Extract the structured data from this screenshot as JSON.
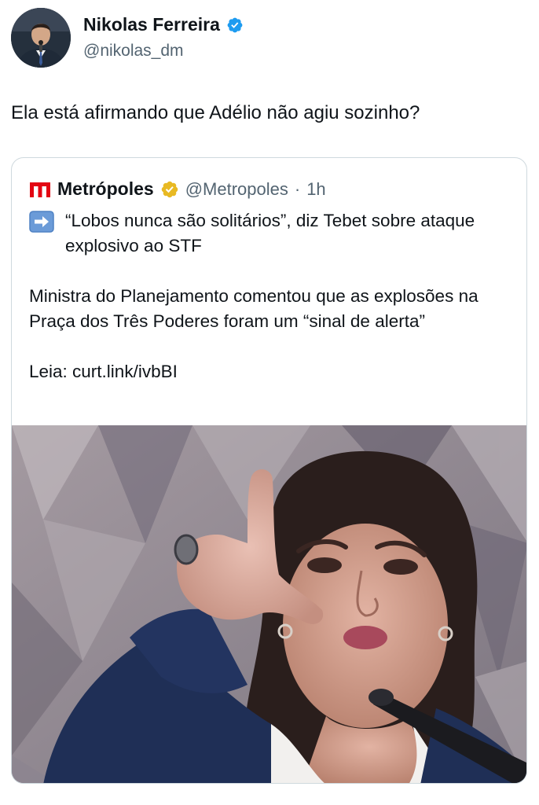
{
  "author": {
    "name": "Nikolas Ferreira",
    "handle": "@nikolas_dm",
    "verified_color": "#1d9bf0"
  },
  "tweet": {
    "text": "Ela está afirmando que Adélio não agiu sozinho?"
  },
  "quoted": {
    "logo_icon": "metropoles-logo-icon",
    "logo_color": "#e30613",
    "name": "Metrópoles",
    "verified_color": "#e8b923",
    "handle": "@Metropoles",
    "separator": "·",
    "time": "1h",
    "emoji_icon": "right-arrow-emoji-icon",
    "headline": "“Lobos nunca são solitários”, diz Tebet sobre ataque explosivo ao STF",
    "paragraph": "Ministra do Planejamento comentou que as explosões na Praça dos Três Poderes foram um “sinal de alerta”",
    "link_prefix": "Leia: ",
    "link": "curt.link/ivbBI",
    "photo_icon": "news-photo-woman-pointing"
  }
}
